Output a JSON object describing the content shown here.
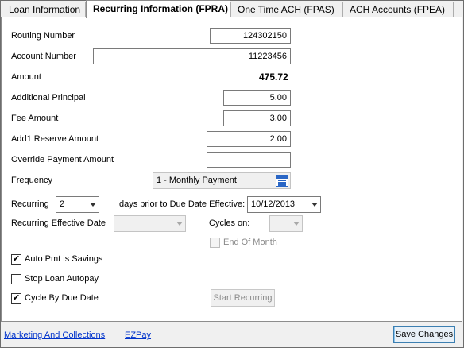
{
  "tabs": [
    {
      "label": "Loan Information"
    },
    {
      "label": "Recurring Information (FPRA)"
    },
    {
      "label": "One Time ACH (FPAS)"
    },
    {
      "label": "ACH Accounts (FPEA)"
    }
  ],
  "form": {
    "routing_number": {
      "label": "Routing Number",
      "value": "124302150"
    },
    "account_number": {
      "label": "Account Number",
      "value": "11223456"
    },
    "amount": {
      "label": "Amount",
      "value": "475.72"
    },
    "additional_principal": {
      "label": "Additional Principal",
      "value": "5.00"
    },
    "fee_amount": {
      "label": "Fee Amount",
      "value": "3.00"
    },
    "addl_reserve": {
      "label": "Add1 Reserve Amount",
      "value": "2.00"
    },
    "override_payment": {
      "label": "Override Payment Amount",
      "value": ""
    },
    "frequency": {
      "label": "Frequency",
      "value": "1 - Monthly Payment",
      "icon": "calendar-list-icon"
    },
    "recurring": {
      "label": "Recurring",
      "value": "2",
      "suffix_label": "days prior to Due Date Effective:",
      "date_value": "10/12/2013"
    },
    "recurring_effective_date": {
      "label": "Recurring Effective Date",
      "value": ""
    },
    "cycles_on": {
      "label": "Cycles on:",
      "value": ""
    },
    "end_of_month": {
      "label": "End Of Month",
      "checked": false,
      "enabled": false
    }
  },
  "checkboxes": {
    "auto_pmt": {
      "label": "Auto Pmt is Savings",
      "checked": true,
      "mark": "✔"
    },
    "stop_loan": {
      "label": "Stop Loan Autopay",
      "checked": false,
      "mark": ""
    },
    "cycle_by_due": {
      "label": "Cycle By Due Date",
      "checked": true,
      "mark": "✔"
    }
  },
  "buttons": {
    "start_recurring": "Start Recurring",
    "save_changes": "Save Changes"
  },
  "footer_links": {
    "marketing": "Marketing And Collections",
    "ezpay": "EZPay"
  }
}
